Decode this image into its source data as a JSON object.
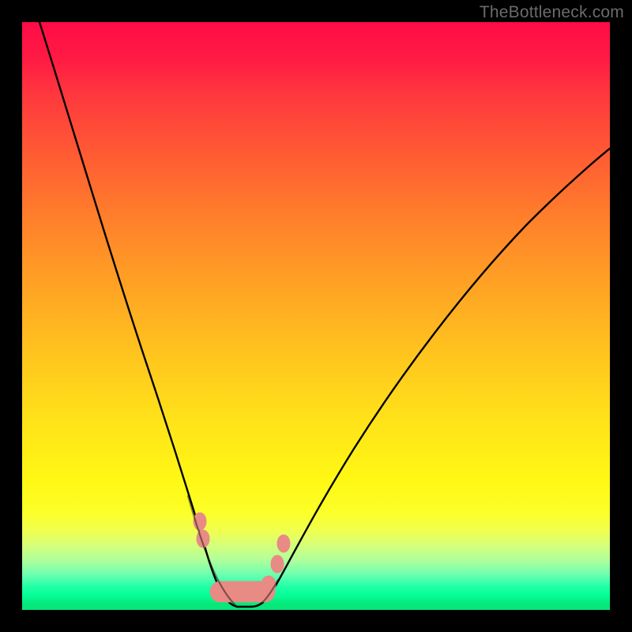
{
  "watermark": "TheBottleneck.com",
  "chart_data": {
    "type": "line",
    "title": "",
    "xlabel": "",
    "ylabel": "",
    "xlim": [
      0,
      100
    ],
    "ylim": [
      0,
      100
    ],
    "note": "Unlabeled bottleneck-style V curve over a vertical rainbow gradient. Values are estimated from pixel positions; no numeric axes are shown.",
    "series": [
      {
        "name": "left-branch",
        "x": [
          3,
          6,
          10,
          14,
          18,
          22,
          25,
          28,
          30,
          31.5,
          33,
          35,
          38
        ],
        "y": [
          100,
          87,
          72,
          56,
          41,
          27,
          17,
          9,
          4,
          2,
          1,
          0.5,
          0.5
        ]
      },
      {
        "name": "right-branch",
        "x": [
          38,
          40,
          42,
          44,
          47,
          52,
          58,
          66,
          76,
          88,
          100
        ],
        "y": [
          0.5,
          1,
          2.5,
          5,
          9,
          17,
          27,
          40,
          54,
          67,
          78
        ]
      },
      {
        "name": "bottom-markers",
        "x": [
          30,
          30.5,
          33,
          36,
          39,
          41,
          42.5,
          43.5
        ],
        "y": [
          15,
          11,
          3,
          2,
          2,
          4,
          8,
          12
        ]
      }
    ],
    "gradient_stops": [
      {
        "pos": 0.0,
        "color": "#ff0c46"
      },
      {
        "pos": 0.23,
        "color": "#ff5d33"
      },
      {
        "pos": 0.56,
        "color": "#ffc31e"
      },
      {
        "pos": 0.78,
        "color": "#fff814"
      },
      {
        "pos": 0.92,
        "color": "#b0ff9b"
      },
      {
        "pos": 1.0,
        "color": "#06e878"
      }
    ]
  }
}
